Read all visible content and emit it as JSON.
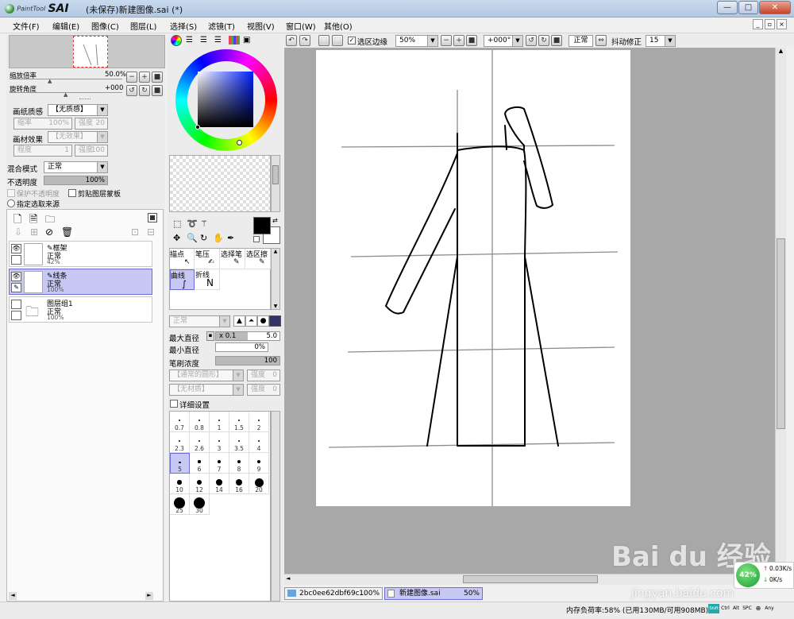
{
  "window": {
    "logo_small": "PaintTool",
    "logo_big": "SAI",
    "title": "(未保存)新建图像.sai (*)",
    "min_label": "—",
    "max_label": "□",
    "close_label": "✕"
  },
  "menu": [
    "文件(F)",
    "编辑(E)",
    "图像(C)",
    "图层(L)",
    "选择(S)",
    "滤镜(T)",
    "视图(V)",
    "窗口(W)",
    "其他(O)"
  ],
  "navigator": {
    "zoom_label": "缩放倍率",
    "zoom_value": "50.0%",
    "rotate_label": "旋转角度",
    "rotate_value": "+000"
  },
  "layer_props": {
    "paper_label": "画纸质感",
    "paper_value": "【无质感】",
    "scale_label": "缩率",
    "scale_value": "100%",
    "strength_label": "强度",
    "strength_value": "20",
    "effect_label": "画材效果",
    "effect_value": "【无效果】",
    "degree_label": "程度",
    "degree_value": "1",
    "strength2_label": "强度",
    "strength2_value": "100",
    "blend_label": "混合模式",
    "blend_value": "正常",
    "opacity_label": "不透明度",
    "opacity_value": "100%",
    "protect_label": "保护不透明度",
    "clip_label": "剪贴图层蒙板",
    "source_label": "指定选取来源"
  },
  "layers": [
    {
      "name": "框架",
      "mode": "正常",
      "opacity": "42%",
      "selected": false
    },
    {
      "name": "线条",
      "mode": "正常",
      "opacity": "100%",
      "selected": true
    },
    {
      "name": "图层组1",
      "mode": "正常",
      "opacity": "100%",
      "selected": false
    }
  ],
  "tools": {
    "tabs": [
      "描点",
      "笔压",
      "选择笔",
      "选区擦"
    ],
    "row2": [
      "曲线",
      "折线"
    ],
    "mode_value": "正常",
    "max_diam_label": "最大直径",
    "max_diam_mult": "x 0.1",
    "max_diam_value": "5.0",
    "min_diam_label": "最小直径",
    "min_diam_value": "0%",
    "density_label": "笔刷浓度",
    "density_value": "100",
    "shape_value": "【通常的圆形】",
    "shape_strength_label": "强度",
    "shape_strength_value": "0",
    "texture_value": "【无材质】",
    "texture_strength_label": "强度",
    "texture_strength_value": "0",
    "detail_label": "详细设置"
  },
  "brush_sizes": [
    "0.7",
    "0.8",
    "1",
    "1.5",
    "2",
    "2.3",
    "2.6",
    "3",
    "3.5",
    "4",
    "5",
    "6",
    "7",
    "8",
    "9",
    "10",
    "12",
    "14",
    "16",
    "20",
    "25",
    "30"
  ],
  "canvas_toolbar": {
    "selection_edge_label": "选区边缘",
    "zoom_value": "50%",
    "angle_value": "+000°",
    "mode_value": "正常",
    "stabilizer_label": "抖动修正",
    "stabilizer_value": "15"
  },
  "tabs": [
    {
      "name": "2bc0ee62dbf69c...",
      "zoom": "100%"
    },
    {
      "name": "新建图像.sai",
      "zoom": "50%"
    }
  ],
  "status": {
    "memory": "内存负荷率:58% (已用130MB/可用908MB)",
    "keys": [
      "Shift",
      "Ctrl",
      "Alt",
      "SPC",
      "⊕",
      "Any"
    ]
  },
  "overlay": {
    "net_percent": "42%",
    "up_speed": "0.03K/s",
    "down_speed": "0K/s",
    "watermark": "Bai du 经验",
    "watermark_url": "jingyan.baidu.com"
  }
}
